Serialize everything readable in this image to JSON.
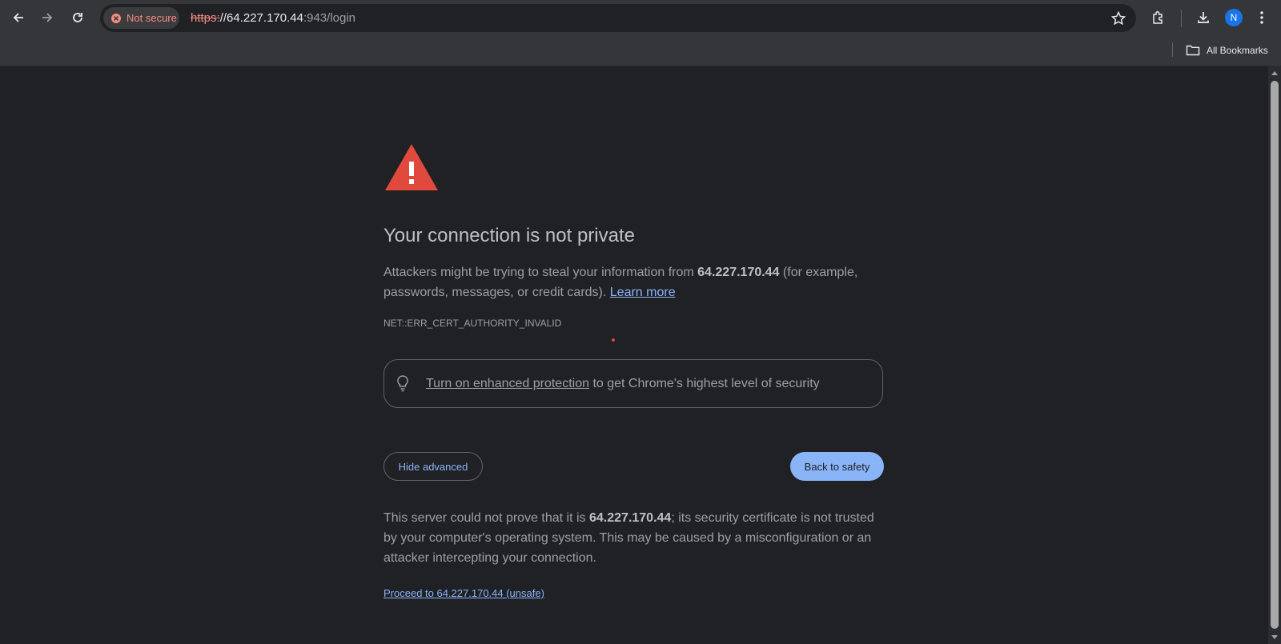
{
  "browser": {
    "security_chip": "Not secure",
    "url_scheme": "https:",
    "url_host": "//64.227.170.44",
    "url_rest": ":943/login",
    "bookmarks_bar": {
      "all_bookmarks": "All Bookmarks"
    },
    "profile_initial": "N"
  },
  "page": {
    "heading": "Your connection is not private",
    "intro_before": "Attackers might be trying to steal your information from ",
    "intro_host": "64.227.170.44",
    "intro_after": " (for example, passwords, messages, or credit cards). ",
    "learn_more": "Learn more",
    "error_code": "NET::ERR_CERT_AUTHORITY_INVALID",
    "enhanced_link": "Turn on enhanced protection",
    "enhanced_rest": " to get Chrome's highest level of security",
    "hide_advanced": "Hide advanced",
    "back_to_safety": "Back to safety",
    "details_before": "This server could not prove that it is ",
    "details_host": "64.227.170.44",
    "details_after": "; its security certificate is not trusted by your computer's operating system. This may be caused by a misconfiguration or an attacker intercepting your connection.",
    "proceed_link": "Proceed to 64.227.170.44 (unsafe)"
  },
  "colors": {
    "background": "#202124",
    "accent": "#8ab4f8",
    "warning": "#e04a3c",
    "not_secure": "#f28b82"
  },
  "icons": [
    "back-arrow-icon",
    "forward-arrow-icon",
    "reload-icon",
    "not-secure-icon",
    "star-icon",
    "extensions-icon",
    "download-icon",
    "folder-icon",
    "warning-triangle-icon",
    "lightbulb-icon"
  ]
}
